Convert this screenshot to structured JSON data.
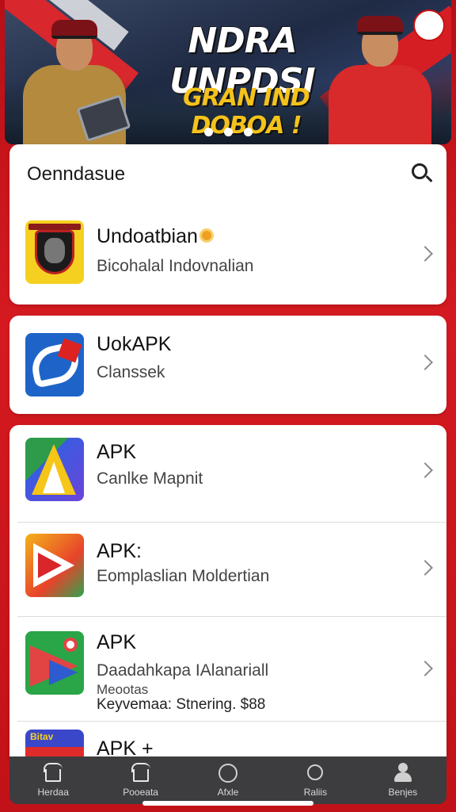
{
  "banner": {
    "title": "NDRA UNPDSI",
    "subtitle": "GRAN IND DOBOA !",
    "carousel_dots": 3
  },
  "search": {
    "placeholder": "Oenndasue"
  },
  "apps": [
    {
      "title": "Undoatbian",
      "subtitle": "Bicohalal Indovnalian",
      "icon": "badge-shield-icon"
    },
    {
      "title": "UokAPK",
      "subtitle": "Clanssek",
      "icon": "uok-logo-icon"
    },
    {
      "title": "APK",
      "subtitle": "Canlke Mapnit",
      "icon": "apk-a-logo-icon"
    },
    {
      "title": "APK:",
      "subtitle": "Eomplaslian Moldertian",
      "icon": "apk-play-logo-icon"
    },
    {
      "title": "APK",
      "subtitle": "Daadahkapa IAlanariall",
      "extra1": "Meootas",
      "extra2": "Keyvemaa: Stnering. $88",
      "icon": "apk-map-logo-icon"
    },
    {
      "title": "APK +",
      "icon_text": "Bitav",
      "icon": "apk-bitav-logo-icon"
    }
  ],
  "nav": {
    "items": [
      {
        "label": "Herdaa",
        "icon": "home-icon"
      },
      {
        "label": "Pooeata",
        "icon": "store-icon"
      },
      {
        "label": "Afxle",
        "icon": "smile-icon"
      },
      {
        "label": "Raliis",
        "icon": "heart-icon"
      },
      {
        "label": "Benjes",
        "icon": "profile-icon"
      }
    ]
  },
  "colors": {
    "background": "#c8141a",
    "card": "#ffffff",
    "nav": "#3d3d3f",
    "banner_title": "#ffffff",
    "banner_subtitle": "#f4c21a"
  }
}
